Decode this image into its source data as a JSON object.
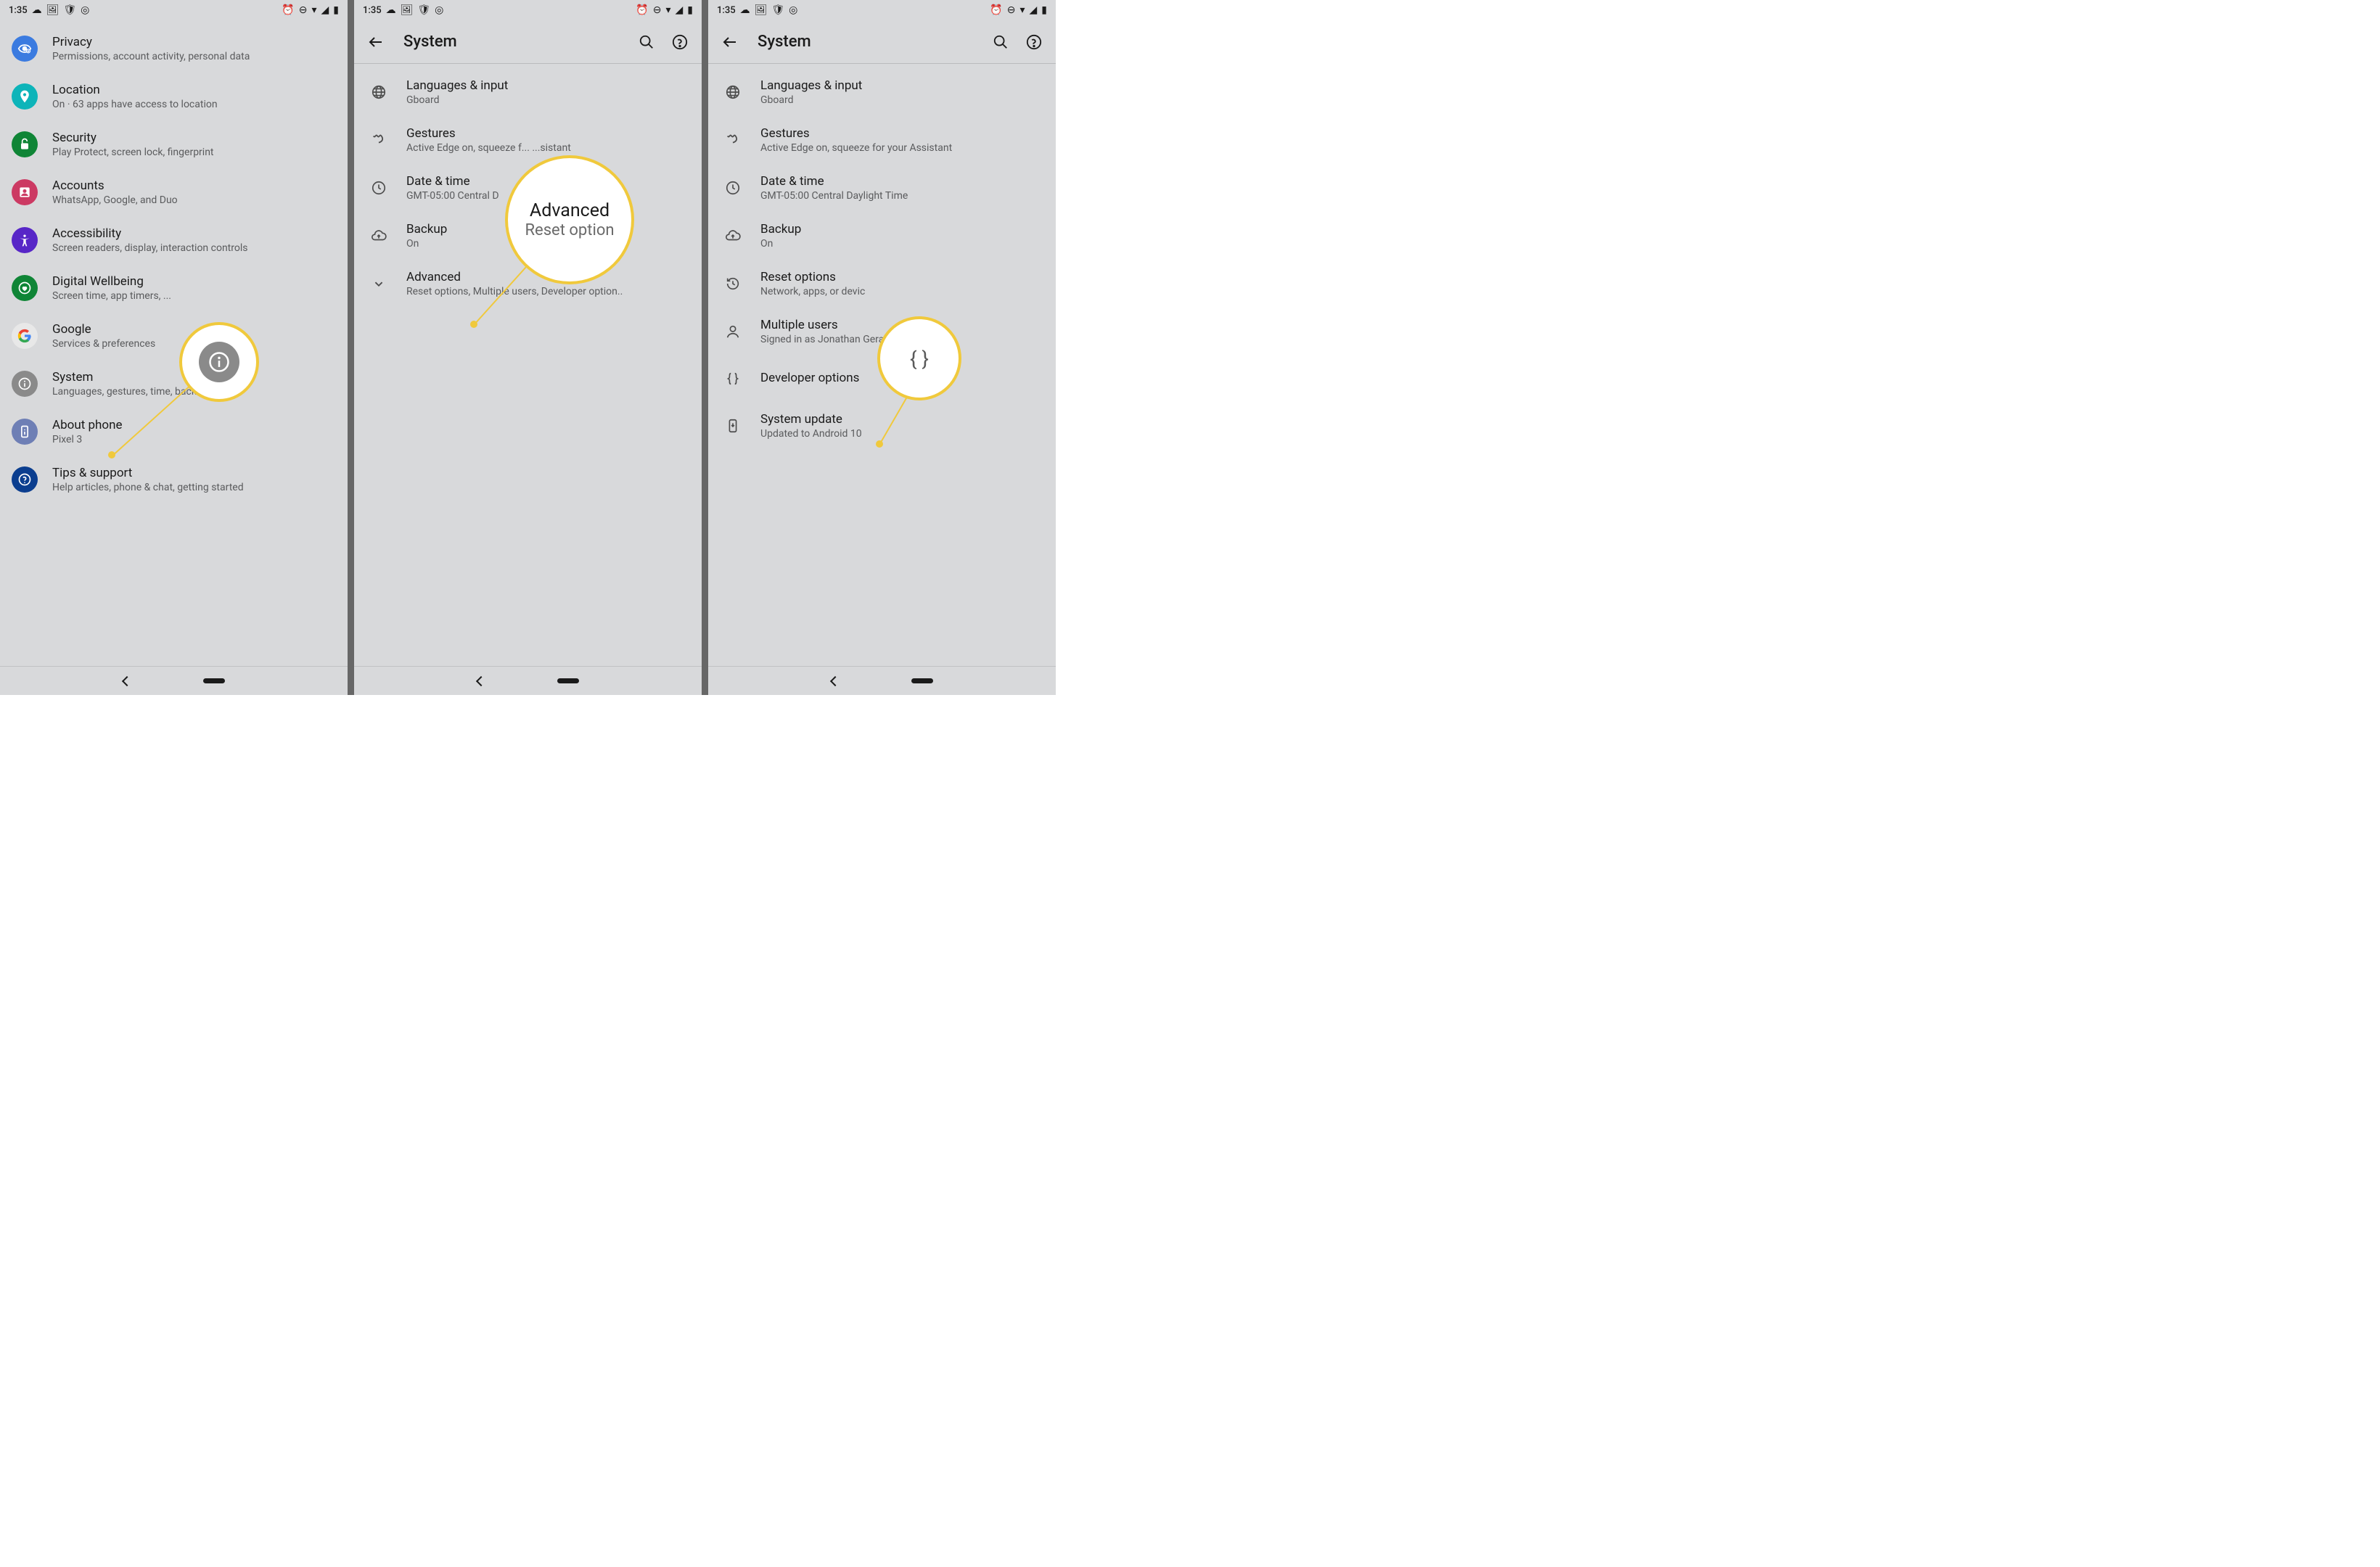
{
  "status": {
    "time": "1:35",
    "left_icons": [
      "cloud",
      "image",
      "shield",
      "steam"
    ],
    "right_icons": [
      "alarm",
      "dnd",
      "wifi",
      "signal",
      "battery"
    ]
  },
  "panel1": {
    "items": [
      {
        "title": "Privacy",
        "sub": "Permissions, account activity, personal data",
        "icon": "privacy",
        "bg": "#3b7be0"
      },
      {
        "title": "Location",
        "sub": "On · 63 apps have access to location",
        "icon": "location",
        "bg": "#0db4b9"
      },
      {
        "title": "Security",
        "sub": "Play Protect, screen lock, fingerprint",
        "icon": "security",
        "bg": "#0f8536"
      },
      {
        "title": "Accounts",
        "sub": "WhatsApp, Google, and Duo",
        "icon": "accounts",
        "bg": "#cc3a63"
      },
      {
        "title": "Accessibility",
        "sub": "Screen readers, display, interaction controls",
        "icon": "accessibility",
        "bg": "#5726c7"
      },
      {
        "title": "Digital Wellbeing",
        "sub": "Screen time, app timers, ...",
        "icon": "wellbeing",
        "bg": "#0f8536"
      },
      {
        "title": "Google",
        "sub": "Services & preferences",
        "icon": "google",
        "bg": "#e8e8e8"
      },
      {
        "title": "System",
        "sub": "Languages, gestures, time, backup",
        "icon": "system",
        "bg": "#8a8a8a"
      },
      {
        "title": "About phone",
        "sub": "Pixel 3",
        "icon": "about",
        "bg": "#6e7fb5"
      },
      {
        "title": "Tips & support",
        "sub": "Help articles, phone & chat, getting started",
        "icon": "help",
        "bg": "#0b3e8f"
      }
    ]
  },
  "panel2": {
    "appbar_title": "System",
    "items": [
      {
        "title": "Languages & input",
        "sub": "Gboard",
        "icon": "globe"
      },
      {
        "title": "Gestures",
        "sub": "Active Edge on, squeeze f...           ...sistant",
        "icon": "gesture"
      },
      {
        "title": "Date & time",
        "sub": "GMT-05:00 Central D",
        "icon": "clock"
      },
      {
        "title": "Backup",
        "sub": "On",
        "icon": "cloud-up"
      },
      {
        "title": "Advanced",
        "sub": "Reset options, Multiple users, Developer option..",
        "icon": "expand"
      }
    ],
    "callout": {
      "title": "Advanced",
      "sub": "Reset option"
    }
  },
  "panel3": {
    "appbar_title": "System",
    "items": [
      {
        "title": "Languages & input",
        "sub": "Gboard",
        "icon": "globe"
      },
      {
        "title": "Gestures",
        "sub": "Active Edge on, squeeze for your Assistant",
        "icon": "gesture"
      },
      {
        "title": "Date & time",
        "sub": "GMT-05:00 Central Daylight Time",
        "icon": "clock"
      },
      {
        "title": "Backup",
        "sub": "On",
        "icon": "cloud-up"
      },
      {
        "title": "Reset options",
        "sub": "Network, apps, or devic",
        "icon": "history"
      },
      {
        "title": "Multiple users",
        "sub": "Signed in as Jonathan Gerard Fisher",
        "icon": "person"
      },
      {
        "title": "Developer options",
        "sub": "",
        "icon": "braces"
      },
      {
        "title": "System update",
        "sub": "Updated to Android 10",
        "icon": "system-update"
      }
    ],
    "callout": {
      "label": "{ }"
    }
  }
}
